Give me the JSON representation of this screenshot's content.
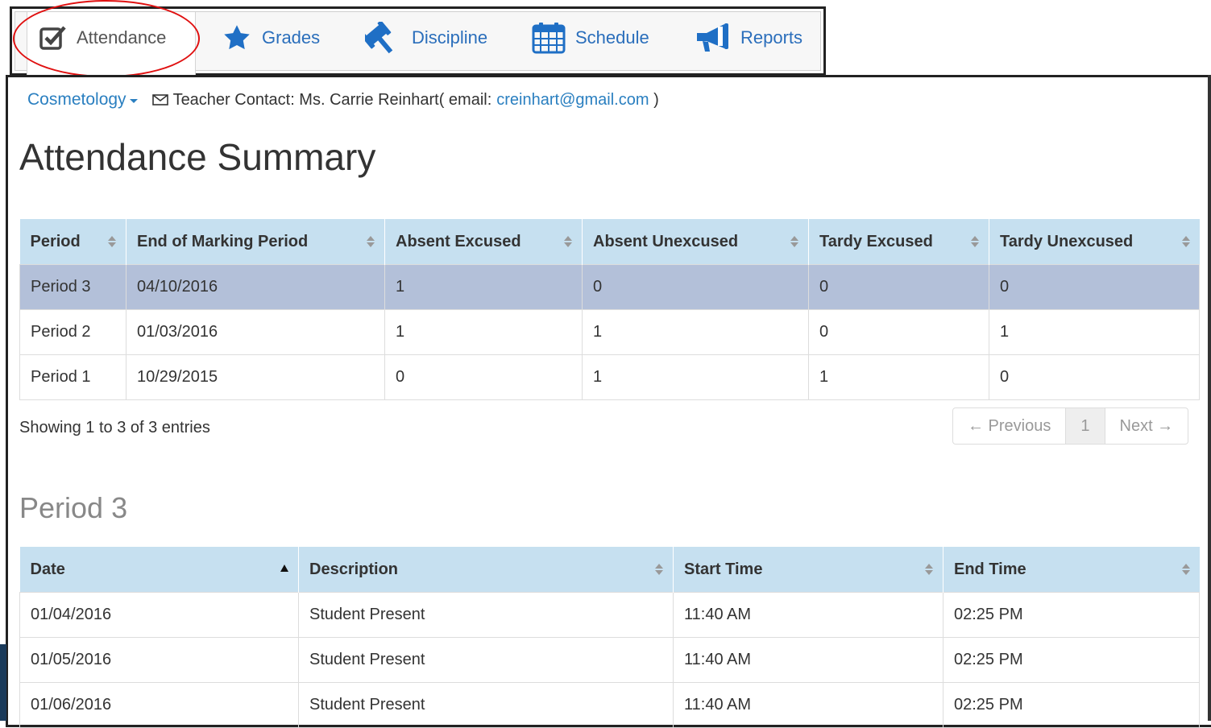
{
  "nav": {
    "tabs": [
      {
        "label": "Attendance",
        "icon": "checkbox-icon"
      },
      {
        "label": "Grades",
        "icon": "star-icon"
      },
      {
        "label": "Discipline",
        "icon": "gavel-icon"
      },
      {
        "label": "Schedule",
        "icon": "calendar-icon"
      },
      {
        "label": "Reports",
        "icon": "megaphone-icon"
      }
    ],
    "active": "Attendance"
  },
  "contact": {
    "course": "Cosmetology",
    "teacher_text": "Teacher Contact: Ms. Carrie Reinhart( email: ",
    "email": "creinhart@gmail.com",
    "close": " )"
  },
  "summary": {
    "title": "Attendance Summary",
    "headers": [
      "Period",
      "End of Marking Period",
      "Absent Excused",
      "Absent Unexcused",
      "Tardy Excused",
      "Tardy Unexcused"
    ],
    "rows": [
      [
        "Period 3",
        "04/10/2016",
        "1",
        "0",
        "0",
        "0"
      ],
      [
        "Period 2",
        "01/03/2016",
        "1",
        "1",
        "0",
        "1"
      ],
      [
        "Period 1",
        "10/29/2015",
        "0",
        "1",
        "1",
        "0"
      ]
    ],
    "showing": "Showing 1 to 3 of 3 entries",
    "pager": {
      "prev": "← Previous",
      "page": "1",
      "next": "Next →"
    }
  },
  "detail": {
    "title": "Period 3",
    "headers": [
      "Date",
      "Description",
      "Start Time",
      "End Time"
    ],
    "rows": [
      [
        "01/04/2016",
        "Student Present",
        "11:40 AM",
        "02:25 PM"
      ],
      [
        "01/05/2016",
        "Student Present",
        "11:40 AM",
        "02:25 PM"
      ],
      [
        "01/06/2016",
        "Student Present",
        "11:40 AM",
        "02:25 PM"
      ]
    ]
  },
  "colors": {
    "accent": "#2a7fc0",
    "header_bg": "#c6e0f0",
    "selected_row": "#b3c0d9",
    "highlight_circle": "#e01010"
  }
}
